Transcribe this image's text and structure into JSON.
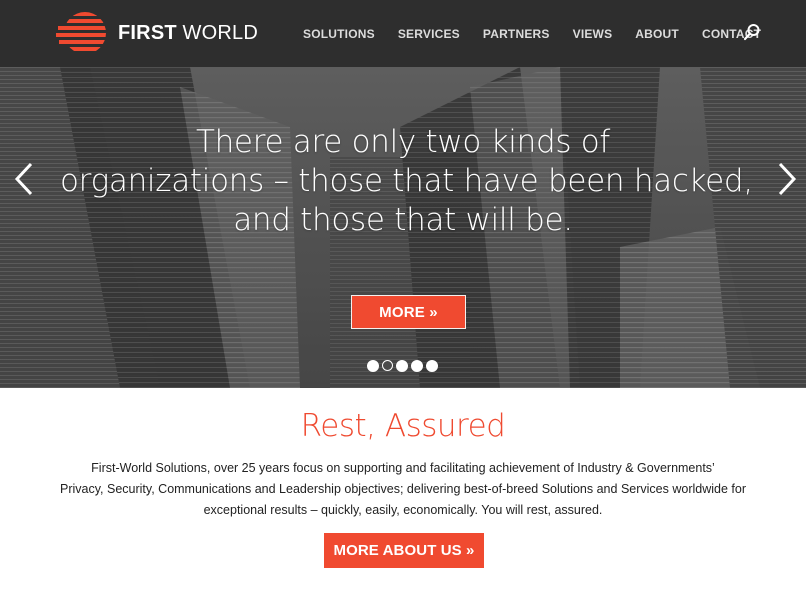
{
  "brand": {
    "name_bold": "FIRST",
    "name_light": "WORLD",
    "accent_color": "#f04a30",
    "header_color": "#2e2e2e"
  },
  "nav": {
    "items": [
      "SOLUTIONS",
      "SERVICES",
      "PARTNERS",
      "VIEWS",
      "ABOUT",
      "CONTACT"
    ],
    "search_icon": "search-icon"
  },
  "hero": {
    "quote_lines": [
      "There are only two kinds of",
      "organizations – those that have been hacked,",
      "and those that will be."
    ],
    "more_label": "MORE »",
    "prev_icon": "chevron-left-icon",
    "next_icon": "chevron-right-icon",
    "slides_total": 5,
    "active_slide": 2
  },
  "about": {
    "title": "Rest, Assured",
    "body_lines": [
      "First-World Solutions, over 25 years focus on supporting and facilitating achievement of Industry & Governments’",
      "Privacy, Security, Communications and Leadership objectives;  delivering best-of-breed Solutions and Services worldwide for",
      "exceptional results – quickly, easily, economically. You will rest, assured."
    ],
    "button_label": "MORE ABOUT US »"
  }
}
